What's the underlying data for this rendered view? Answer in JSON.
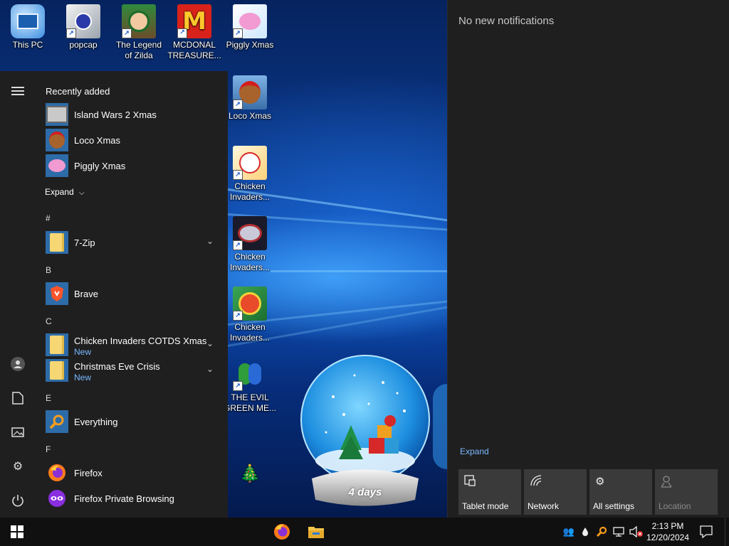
{
  "desktop": {
    "icons": [
      {
        "label": "This PC",
        "icon": "computer-icon"
      },
      {
        "label": "popcap",
        "icon": "folder-icon"
      },
      {
        "label": "The Legend of Zilda",
        "icon": "game-icon"
      },
      {
        "label": "MCDONAL TREASURE...",
        "icon": "mcdonalds-icon"
      },
      {
        "label": "Piggly Xmas",
        "icon": "pig-icon"
      },
      {
        "label": "Loco Xmas",
        "icon": "bear-icon"
      },
      {
        "label": "Chicken Invaders...",
        "icon": "chicken-icon"
      },
      {
        "label": "Chicken Invaders...",
        "icon": "chicken-icon"
      },
      {
        "label": "Chicken Invaders...",
        "icon": "chicken-icon"
      },
      {
        "label": "THE EVIL GREEN ME...",
        "icon": "messenger-icon"
      }
    ],
    "snow_globe_text": "4 days"
  },
  "start_menu": {
    "recently_added_label": "Recently added",
    "recent": [
      {
        "name": "Island Wars 2 Xmas",
        "icon": "island-icon"
      },
      {
        "name": "Loco Xmas",
        "icon": "bear-icon"
      },
      {
        "name": "Piggly Xmas",
        "icon": "pig-icon"
      }
    ],
    "expand_label": "Expand",
    "groups": [
      {
        "letter": "#",
        "apps": [
          {
            "name": "7-Zip",
            "type": "folder",
            "has_chevron": true
          }
        ]
      },
      {
        "letter": "B",
        "apps": [
          {
            "name": "Brave",
            "type": "brave"
          }
        ]
      },
      {
        "letter": "C",
        "apps": [
          {
            "name": "Chicken Invaders COTDS Xmas",
            "sub": "New",
            "type": "folder",
            "has_chevron": true
          },
          {
            "name": "Christmas Eve Crisis",
            "sub": "New",
            "type": "folder",
            "has_chevron": true
          }
        ]
      },
      {
        "letter": "E",
        "apps": [
          {
            "name": "Everything",
            "type": "everything"
          }
        ]
      },
      {
        "letter": "F",
        "apps": [
          {
            "name": "Firefox",
            "type": "firefox"
          },
          {
            "name": "Firefox Private Browsing",
            "type": "firefox-private"
          }
        ]
      }
    ],
    "rail_icons": [
      "hamburger-icon",
      "user-icon",
      "documents-icon",
      "pictures-icon",
      "settings-icon",
      "power-icon"
    ]
  },
  "action_center": {
    "no_notifications": "No new notifications",
    "expand_label": "Expand",
    "quick_actions": [
      {
        "label": "Tablet mode",
        "icon": "tablet-mode-icon",
        "enabled": true
      },
      {
        "label": "Network",
        "icon": "network-icon",
        "enabled": true
      },
      {
        "label": "All settings",
        "icon": "gear-icon",
        "enabled": true
      },
      {
        "label": "Location",
        "icon": "location-icon",
        "enabled": false
      }
    ]
  },
  "taskbar": {
    "pinned": [
      "firefox-icon",
      "file-explorer-icon"
    ],
    "tray_icons": [
      "people-icon",
      "drop-icon",
      "everything-search-icon",
      "network-icon",
      "volume-muted-icon"
    ],
    "time": "2:13 PM",
    "date": "12/20/2024"
  },
  "colors": {
    "menu_bg": "#1f1f1f",
    "accent": "#79b8ff",
    "taskbar_bg": "#101010"
  }
}
